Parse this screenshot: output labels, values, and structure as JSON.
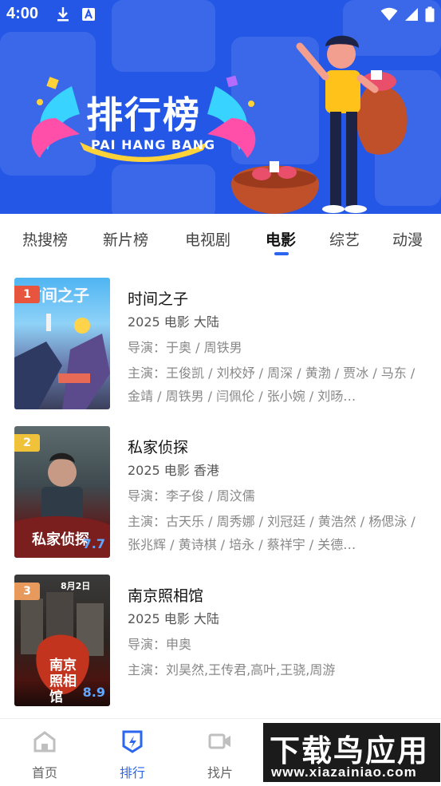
{
  "status_bar": {
    "time": "4:00"
  },
  "banner": {
    "title": "排行榜",
    "subtitle": "PAI HANG BANG"
  },
  "tabs": [
    {
      "label": "热搜榜"
    },
    {
      "label": "新片榜"
    },
    {
      "label": "电视剧"
    },
    {
      "label": "电影",
      "active": true
    },
    {
      "label": "综艺"
    },
    {
      "label": "动漫"
    }
  ],
  "items": [
    {
      "rank": "1",
      "rank_color": "#e8553f",
      "title": "时间之子",
      "meta": "2025  电影  大陆",
      "director": "导演：于奥 / 周铁男",
      "cast": "主演：王俊凯 / 刘校妤 / 周深 / 黄渤 / 贾冰 / 马东 / 金靖 / 周铁男 / 闫佩伦 / 张小婉 / 刘旸…",
      "poster_text": "时间之子"
    },
    {
      "rank": "2",
      "rank_color": "#f0c23a",
      "title": "私家侦探",
      "meta": "2025  电影  香港",
      "director": "导演：李子俊 / 周汶儒",
      "cast": "主演：古天乐 / 周秀娜 / 刘冠廷 / 黄浩然 / 杨偲泳 / 张兆辉 / 黄诗棋 / 培永 / 蔡祥宇 / 关德…",
      "poster_text": "私家侦探",
      "poster_score": "7.7"
    },
    {
      "rank": "3",
      "rank_color": "#e89a5c",
      "title": "南京照相馆",
      "meta": "2025  电影  大陆",
      "director": "导演：申奥",
      "cast": "主演：刘昊然,王传君,高叶,王骁,周游",
      "poster_text": "南京照相馆",
      "poster_score": "8.9"
    }
  ],
  "bottom_nav": [
    {
      "label": "首页",
      "icon": "home-icon"
    },
    {
      "label": "排行",
      "icon": "ranking-icon",
      "active": true
    },
    {
      "label": "找片",
      "icon": "video-icon"
    }
  ],
  "watermark": {
    "big": "下载鸟应用",
    "small": "www.xiazainiao.com"
  },
  "colors": {
    "accent": "#2a66ee",
    "banner": "#2457e6"
  }
}
